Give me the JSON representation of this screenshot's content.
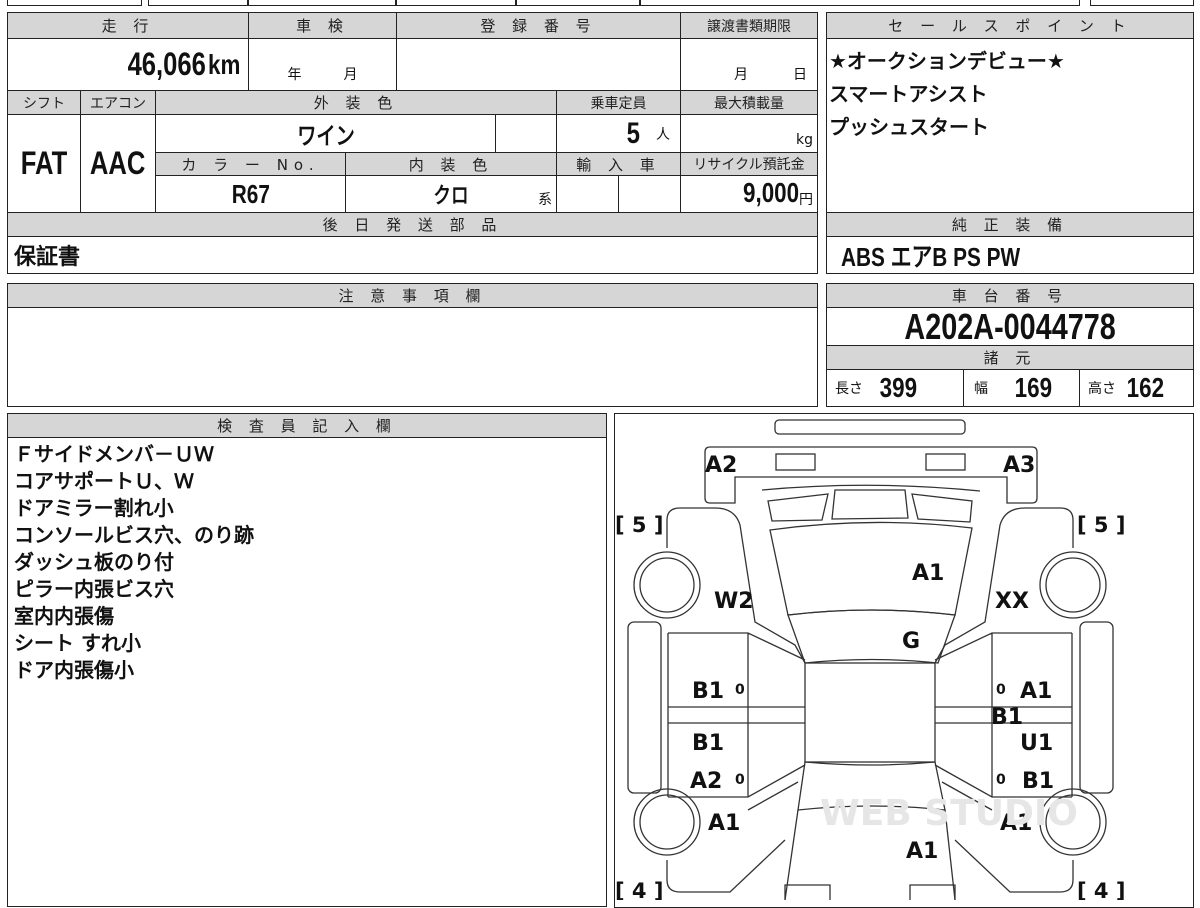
{
  "vehicle": {
    "mileage_label": "走 行",
    "mileage": "46,066",
    "mileage_unit": "km",
    "inspection_label": "車 検",
    "year_unit": "年",
    "month_unit": "月",
    "registration_label": "登 録 番 号",
    "transfer_deadline_label": "譲渡書類期限",
    "day_unit": "日",
    "shift_label": "シフト",
    "shift": "FAT",
    "ac_label": "エアコン",
    "ac": "AAC",
    "exterior_color_label": "外 装 色",
    "exterior_color": "ワイン",
    "capacity_label": "乗車定員",
    "capacity": "5",
    "capacity_unit": "人",
    "max_load_label": "最大積載量",
    "max_load_unit": "kg",
    "color_no_label": "カ ラ ー No.",
    "color_no": "R67",
    "interior_color_label": "内 装 色",
    "interior_color": "クロ",
    "interior_suffix": "系",
    "import_label": "輸 入 車",
    "recycle_label": "リサイクル預託金",
    "recycle_fee": "9,000",
    "recycle_unit": "円",
    "later_parts_label": "後 日 発 送 部 品",
    "later_parts": "保証書"
  },
  "sales_points": {
    "label": "セ ー ル ス ポ イ ン ト",
    "lines": [
      "★オークションデビュー★",
      "スマートアシスト",
      "プッシュスタート"
    ]
  },
  "equipment": {
    "label": "純 正 装 備",
    "value": "ABS エアB PS PW"
  },
  "notes": {
    "label": "注 意 事 項 欄"
  },
  "chassis": {
    "label": "車 台 番 号",
    "value": "A202A-0044778",
    "spec_label": "諸 元",
    "length_label": "長さ",
    "length": "399",
    "width_label": "幅",
    "width": "169",
    "height_label": "高さ",
    "height": "162"
  },
  "inspector": {
    "label": "検 査 員 記 入 欄",
    "lines": [
      "Ｆサイドメンバ－ＵＷ",
      "コアサポートＵ、Ｗ",
      "ドアミラー割れ小",
      "コンソールビス穴、のり跡",
      "ダッシュ板のり付",
      "ピラー内張ビス穴",
      "室内内張傷",
      "シート すれ小",
      "ドア内張傷小"
    ]
  },
  "diagram": {
    "marks": {
      "rear_left": "A2",
      "rear_right": "A3",
      "rear_glass": "A1",
      "left_rear_quarter": "W2",
      "right_rear_quarter": "XX",
      "roof": "G",
      "left_rear_door": "B1",
      "left_rear_door_zero": "0",
      "right_rear_door": "A1",
      "right_rear_door_zero": "0",
      "right_sill": "B1",
      "left_front_door": "B1",
      "right_front_door": "U1",
      "left_front_door_lower": "A2",
      "left_front_zero": "0",
      "right_front_zero": "0",
      "right_front_door_lower": "B1",
      "left_front_fender": "A1",
      "right_front_fender": "A1",
      "hood": "A1"
    },
    "tire_rear_left": "[ 5 ]",
    "tire_rear_right": "[ 5 ]",
    "tire_front_left": "[ 4 ]",
    "tire_front_right": "[ 4 ]",
    "watermark": "WEB STUDIO"
  }
}
